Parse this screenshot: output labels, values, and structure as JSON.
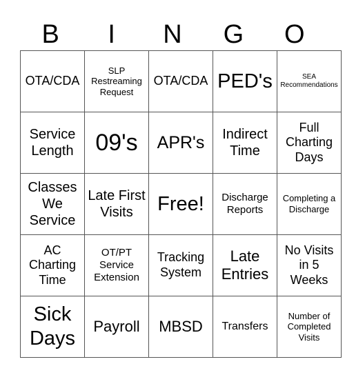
{
  "header": {
    "letters": [
      "B",
      "I",
      "N",
      "G",
      "O"
    ]
  },
  "board": {
    "rows": [
      [
        "OTA/CDA",
        "SLP Restreaming Request",
        "OTA/CDA",
        "PED's",
        "SEA Recommendations"
      ],
      [
        "Service Length",
        "09's",
        "APR's",
        "Indirect Time",
        "Full Charting Days"
      ],
      [
        "Classes We Service",
        "Late First Visits",
        "Free!",
        "Discharge Reports",
        "Completing a Discharge"
      ],
      [
        "AC Charting Time",
        "OT/PT Service Extension",
        "Tracking System",
        "Late Entries",
        "No Visits in 5 Weeks"
      ],
      [
        "Sick Days",
        "Payroll",
        "MBSD",
        "Transfers",
        "Number of Completed Visits"
      ]
    ]
  }
}
